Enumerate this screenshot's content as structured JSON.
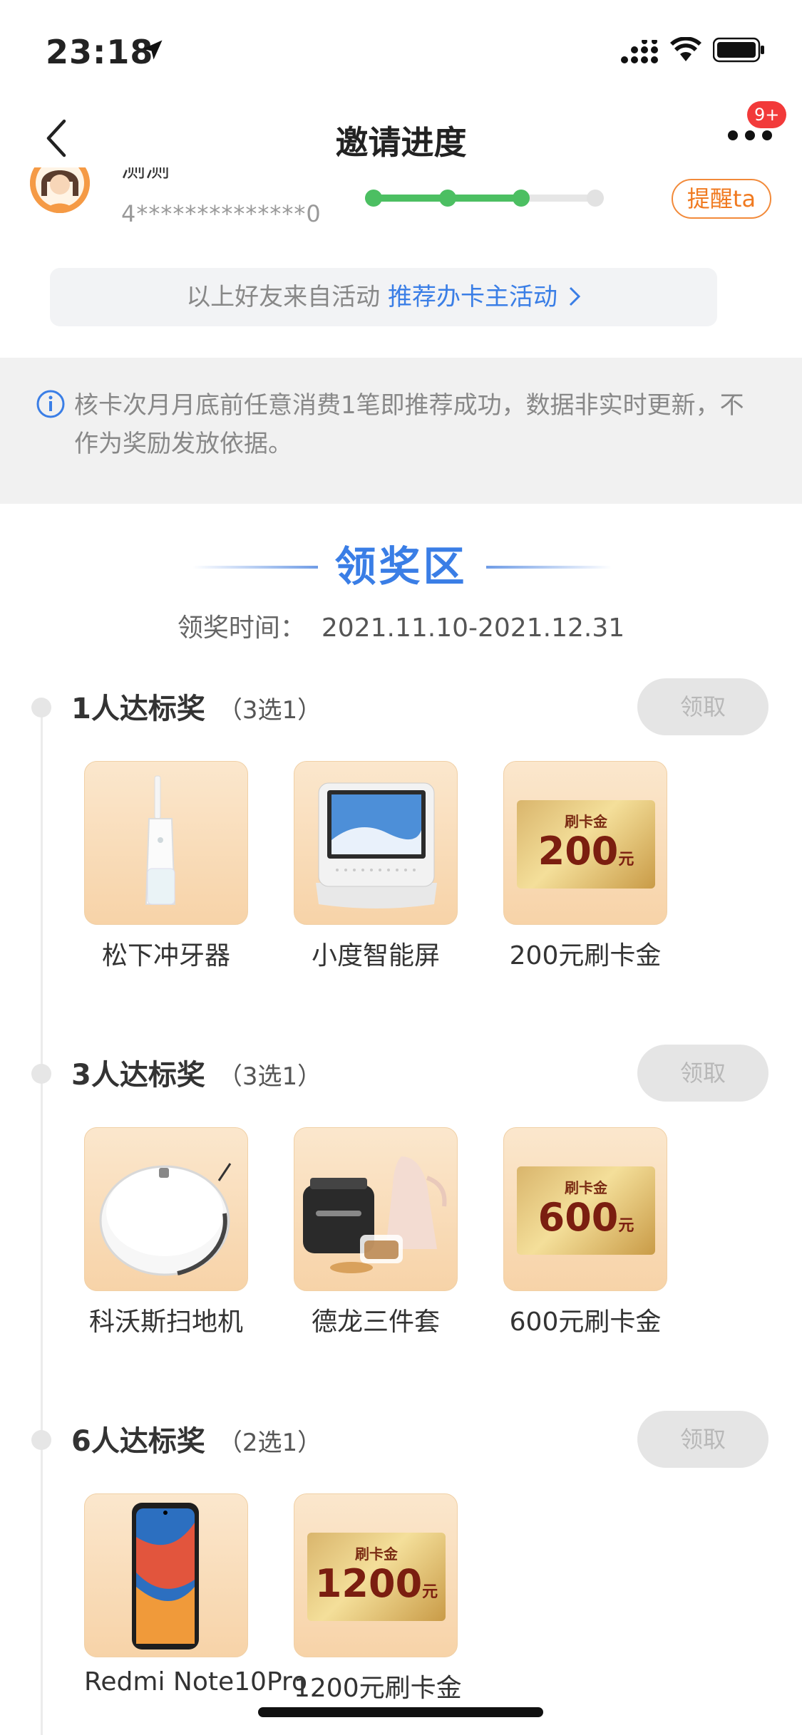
{
  "status_bar": {
    "time": "23:18"
  },
  "nav": {
    "title": "邀请进度",
    "badge": "9+"
  },
  "friend": {
    "name": "测测",
    "card_number": "4**************0",
    "progress_steps_total": 4,
    "progress_steps_done": 3,
    "remind_label": "提醒ta"
  },
  "source": {
    "text": "以上好友来自活动",
    "link": "推荐办卡主活动"
  },
  "notice": {
    "text": "核卡次月月底前任意消费1笔即推荐成功，数据非实时更新，不作为奖励发放依据。"
  },
  "award": {
    "title": "领奖区",
    "time_label": "领奖时间：",
    "time_value": "2021.11.10-2021.12.31"
  },
  "tiers": [
    {
      "title": "1人达标奖",
      "note": "（3选1）",
      "claim_label": "领取",
      "prizes": [
        {
          "name": "松下冲牙器",
          "icon": "water-flosser"
        },
        {
          "name": "小度智能屏",
          "icon": "smart-display"
        },
        {
          "name": "200元刷卡金",
          "icon": "gold-card",
          "card_label": "刷卡金",
          "card_amount": "200",
          "card_unit": "元"
        }
      ]
    },
    {
      "title": "3人达标奖",
      "note": "（3选1）",
      "claim_label": "领取",
      "prizes": [
        {
          "name": "科沃斯扫地机",
          "icon": "robot-vacuum"
        },
        {
          "name": "德龙三件套",
          "icon": "kitchen-set"
        },
        {
          "name": "600元刷卡金",
          "icon": "gold-card",
          "card_label": "刷卡金",
          "card_amount": "600",
          "card_unit": "元"
        }
      ]
    },
    {
      "title": "6人达标奖",
      "note": "（2选1）",
      "claim_label": "领取",
      "prizes": [
        {
          "name": "Redmi Note10Pro",
          "icon": "smartphone"
        },
        {
          "name": "1200元刷卡金",
          "icon": "gold-card",
          "card_label": "刷卡金",
          "card_amount": "1200",
          "card_unit": "元"
        }
      ]
    }
  ]
}
